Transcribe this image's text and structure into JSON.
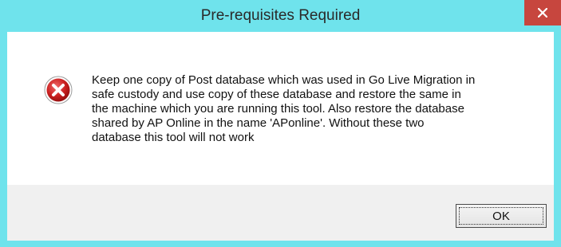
{
  "window": {
    "title": "Pre-requisites Required",
    "close_icon": "close-icon",
    "accent_color": "#6fe3ec",
    "close_color": "#c7463e"
  },
  "dialog": {
    "icon": "error-icon",
    "message": "Keep one copy of Post database which was used in Go Live Migration in\nsafe custody and use copy of these database  and restore the same in\nthe machine which you are running this tool. Also restore the database\nshared by AP Online in the name 'APonline'. Without these two\ndatabase this tool will not work",
    "ok_label": "OK"
  }
}
